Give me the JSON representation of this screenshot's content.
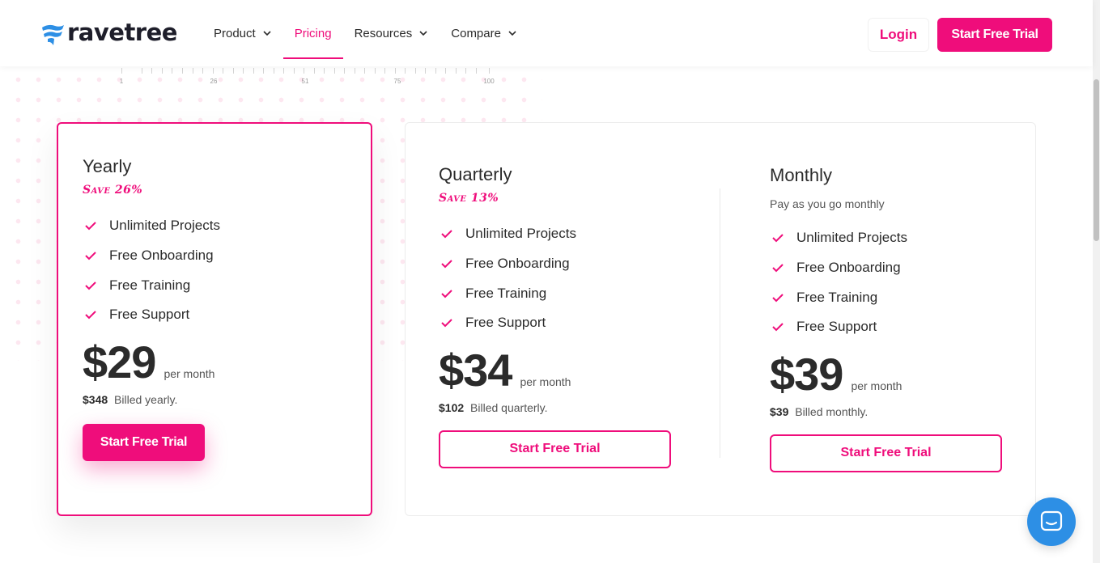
{
  "brand": {
    "name": "ravetree",
    "accent": "#ef0d7b",
    "chat_color": "#2d8fe5"
  },
  "nav": {
    "items": [
      {
        "label": "Product",
        "has_dropdown": true
      },
      {
        "label": "Pricing",
        "active": true
      },
      {
        "label": "Resources",
        "has_dropdown": true
      },
      {
        "label": "Compare",
        "has_dropdown": true
      }
    ],
    "login_label": "Login",
    "cta_label": "Start Free Trial"
  },
  "ruler": {
    "labels": [
      "1",
      "26",
      "51",
      "75",
      "100"
    ]
  },
  "plans": [
    {
      "title": "Yearly",
      "save": "Save 26%",
      "features": [
        "Unlimited Projects",
        "Free Onboarding",
        "Free Training",
        "Free Support"
      ],
      "price": "$29",
      "per": "per month",
      "billed_amount": "$348",
      "billed_text": "Billed yearly.",
      "cta": "Start Free Trial"
    },
    {
      "title": "Quarterly",
      "save": "Save 13%",
      "features": [
        "Unlimited Projects",
        "Free Onboarding",
        "Free Training",
        "Free Support"
      ],
      "price": "$34",
      "per": "per month",
      "billed_amount": "$102",
      "billed_text": "Billed quarterly.",
      "cta": "Start Free Trial"
    },
    {
      "title": "Monthly",
      "subtitle": "Pay as you go monthly",
      "features": [
        "Unlimited Projects",
        "Free Onboarding",
        "Free Training",
        "Free Support"
      ],
      "price": "$39",
      "per": "per month",
      "billed_amount": "$39",
      "billed_text": "Billed monthly.",
      "cta": "Start Free Trial"
    }
  ],
  "icons": {
    "logo": "ravetree-logo-icon",
    "chevron": "chevron-down-icon",
    "check": "check-icon",
    "chat": "chat-icon"
  }
}
